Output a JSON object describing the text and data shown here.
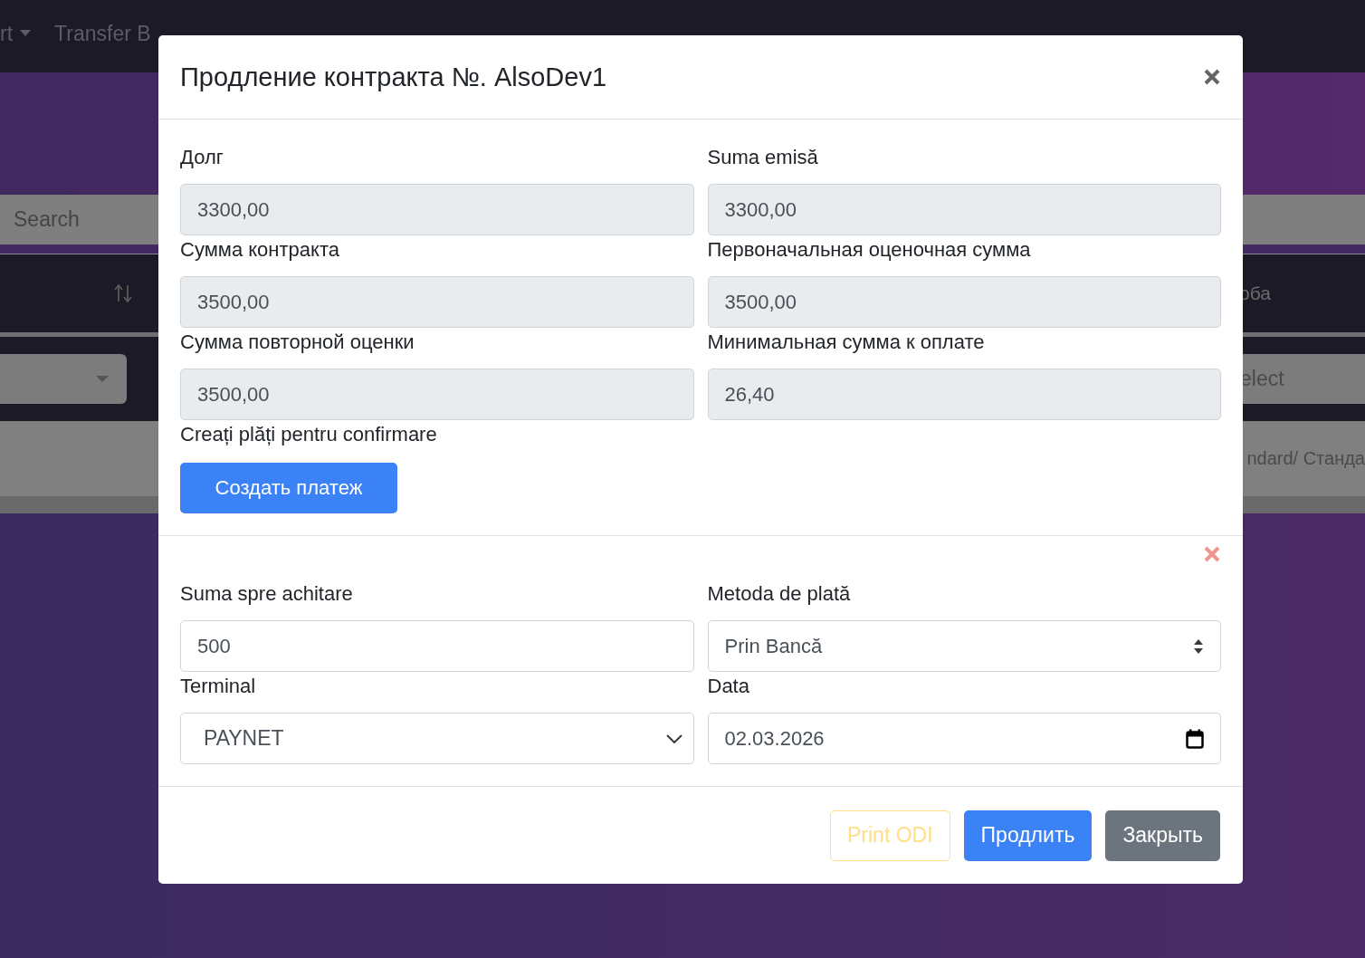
{
  "background": {
    "nav": [
      {
        "label": "rt",
        "dropdown": true
      },
      {
        "label": "Transfer B",
        "dropdown": false
      }
    ],
    "search": {
      "placeholder": "Search"
    },
    "table_header": {
      "column_2": "оба"
    },
    "filter": {
      "placeholder": "elect"
    },
    "row": {
      "cell": "ndard/ Станда"
    }
  },
  "modal": {
    "title": "Продление контракта №. AlsoDev1",
    "fields": [
      {
        "label": "Долг",
        "value": "3300,00",
        "disabled": true
      },
      {
        "label": "Suma emisă",
        "value": "3300,00",
        "disabled": true
      },
      {
        "label": "Сумма контракта",
        "value": "3500,00",
        "disabled": true
      },
      {
        "label": "Первоначальная оценочная сумма",
        "value": "3500,00",
        "disabled": true
      },
      {
        "label": "Сумма повторной оценки",
        "value": "3500,00",
        "disabled": true
      },
      {
        "label": "Минимальная сумма к оплате",
        "value": "26,40",
        "disabled": true
      }
    ],
    "confirm_label": "Creați plăți pentru confirmare",
    "create_button": "Создать платеж",
    "payment": [
      {
        "label": "Suma spre achitare",
        "kind": "text",
        "value": "500",
        "disabled": false
      },
      {
        "label": "Metoda de plată",
        "kind": "select",
        "value": "Prin Bancă",
        "disabled": false
      },
      {
        "label": "Terminal",
        "kind": "dropdown",
        "value": "PAYNET",
        "disabled": false
      },
      {
        "label": "Data",
        "kind": "date",
        "value": "02.03.2026",
        "disabled": false
      }
    ],
    "buttons": [
      {
        "label": "Print ODI",
        "kind": "warning-outline",
        "disabled": true
      },
      {
        "label": "Продлить",
        "kind": "primary",
        "disabled": false
      },
      {
        "label": "Закрыть",
        "kind": "secondary",
        "disabled": false
      }
    ]
  }
}
